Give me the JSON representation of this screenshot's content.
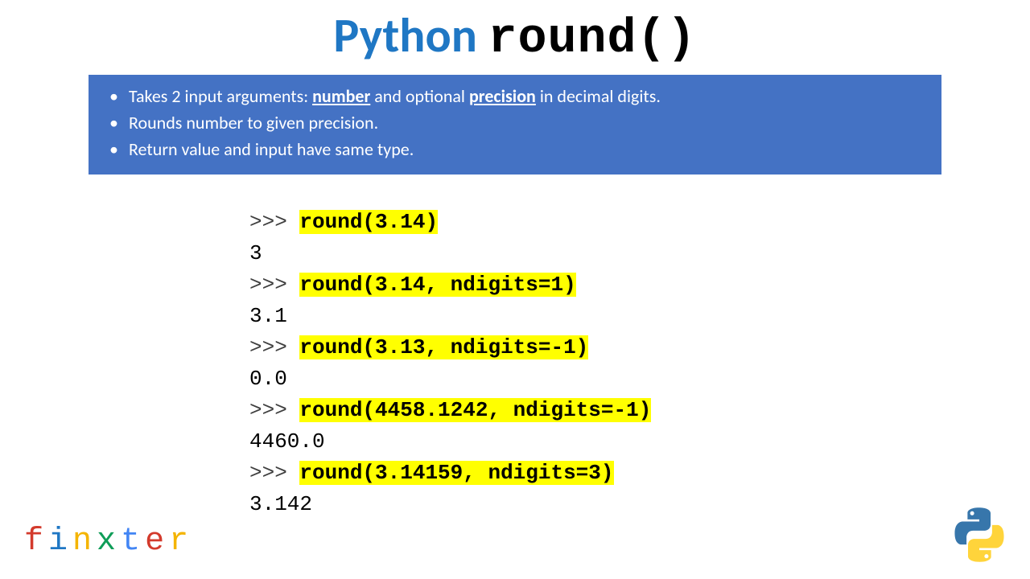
{
  "title": {
    "word1": "Python",
    "word2": "round()"
  },
  "info": {
    "line1_pre": "Takes 2 input arguments: ",
    "line1_key1": "number",
    "line1_mid": " and optional ",
    "line1_key2": "precision",
    "line1_post": " in decimal digits.",
    "line2": "Rounds number to given precision.",
    "line3": "Return value and input have same type."
  },
  "code": {
    "prompt": ">>> ",
    "ex1_call": "round(3.14)",
    "ex1_out": "3",
    "ex2_call": "round(3.14, ndigits=1)",
    "ex2_out": "3.1",
    "ex3_call": "round(3.13, ndigits=-1)",
    "ex3_out": "0.0",
    "ex4_call": "round(4458.1242, ndigits=-1)",
    "ex4_out": "4460.0",
    "ex5_call": "round(3.14159, ndigits=3)",
    "ex5_out": "3.142"
  },
  "brand": {
    "c1": "f",
    "c2": "i",
    "c3": "n",
    "c4": "x",
    "c5": "t",
    "c6": "e",
    "c7": "r"
  }
}
